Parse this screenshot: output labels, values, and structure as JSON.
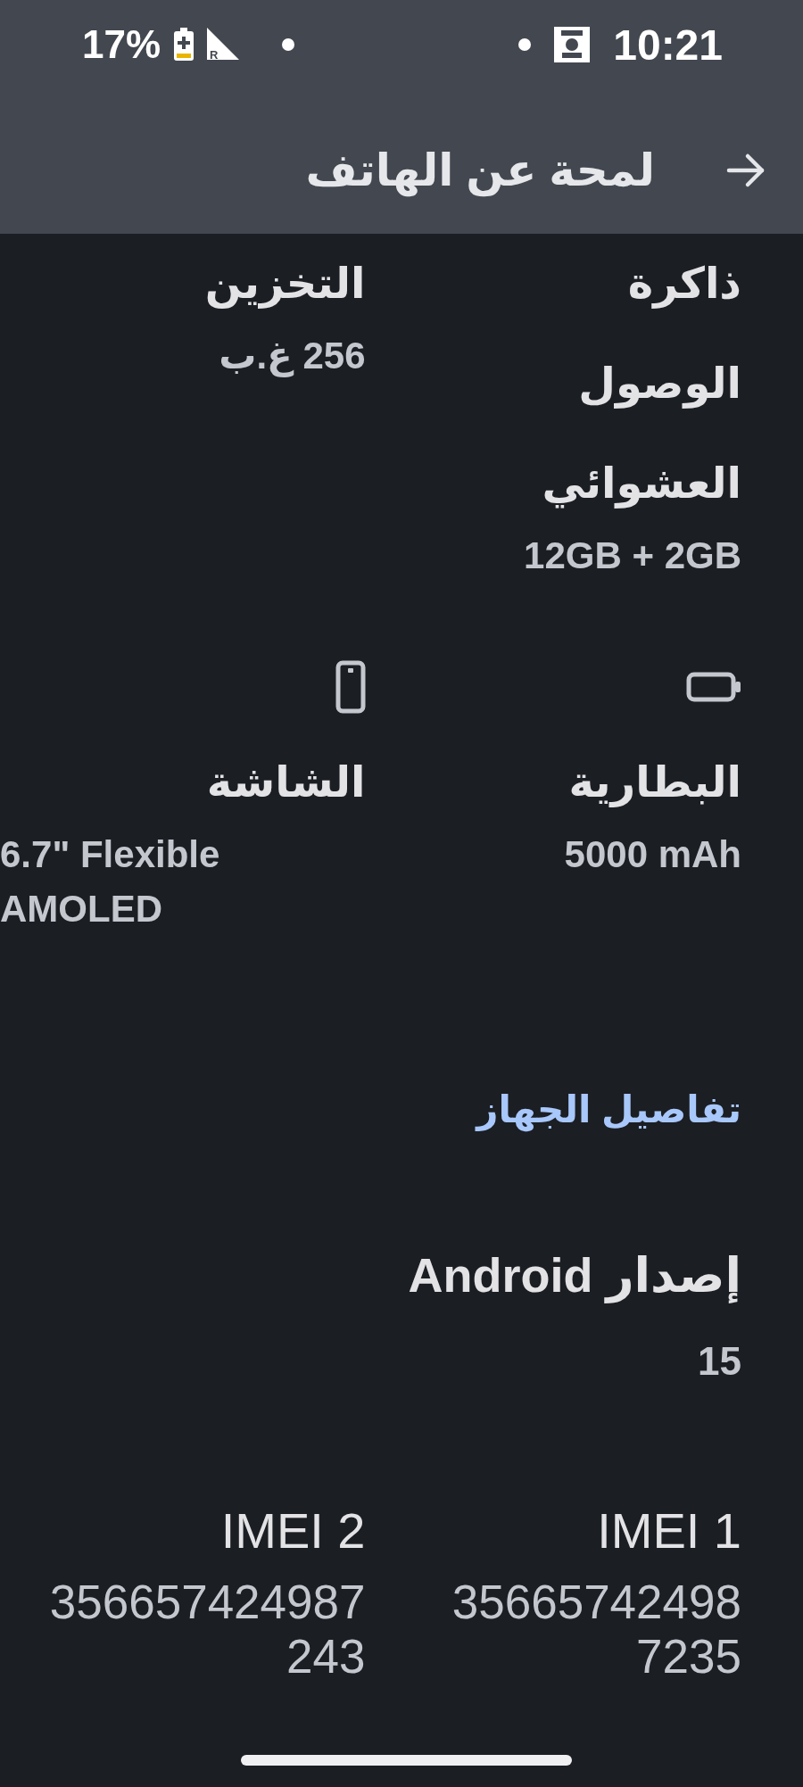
{
  "status_bar": {
    "battery_text": "17%",
    "network_tag": "R",
    "time": "10:21"
  },
  "header": {
    "title": "لمحة عن الهاتف"
  },
  "spec_rows": [
    {
      "kind": "plain",
      "cells": [
        {
          "label": "ذاكرة الوصول العشوائي",
          "value": "12GB + 2GB"
        },
        {
          "label": "التخزين",
          "value": "256 غ.ب"
        }
      ]
    },
    {
      "kind": "icons",
      "cells": [
        {
          "label": "البطارية",
          "value": "5000 mAh"
        },
        {
          "label": "الشاشة",
          "value": "6.7\" Flexible AMOLED"
        }
      ]
    }
  ],
  "device_details": {
    "heading": "تفاصيل الجهاز",
    "android": {
      "label": "إصدار Android",
      "value": "15"
    },
    "imei": [
      {
        "label": "IMEI 1",
        "value": "356657424987235"
      },
      {
        "label": "IMEI 2",
        "value": "356657424987243"
      }
    ]
  }
}
